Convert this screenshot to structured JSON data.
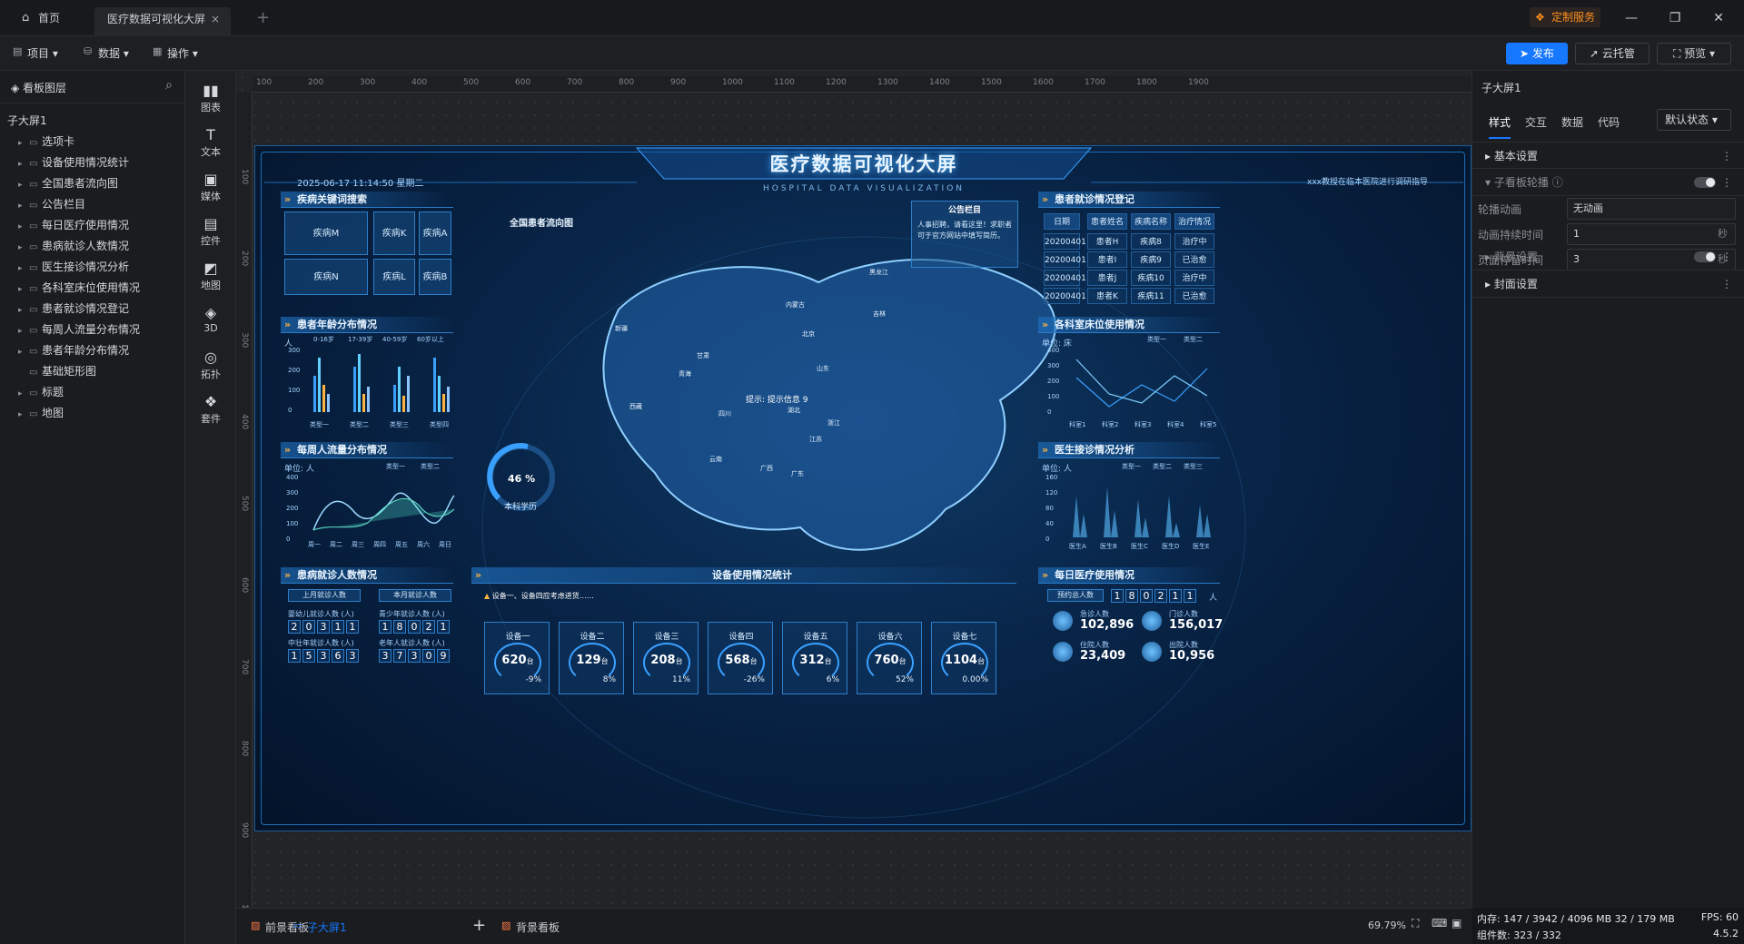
{
  "tabs": {
    "home": "首页",
    "active": "医疗数据可视化大屏",
    "close": "×",
    "add": "+"
  },
  "header": {
    "custom_service": "定制服务",
    "minimize": "—",
    "restore": "❐",
    "close": "✕"
  },
  "toolbar": {
    "menus": [
      {
        "label": "项目",
        "icon": "▤"
      },
      {
        "label": "数据",
        "icon": "⛁"
      },
      {
        "label": "操作",
        "icon": "▦"
      }
    ],
    "publish": "发布",
    "cloud": "云托管",
    "preview": "预览"
  },
  "layers": {
    "title": "看板图层",
    "root": "子大屏1",
    "items": [
      "选项卡",
      "设备使用情况统计",
      "全国患者流向图",
      "公告栏目",
      "每日医疗使用情况",
      "患病就诊人数情况",
      "医生接诊情况分析",
      "各科室床位使用情况",
      "患者就诊情况登记",
      "每周人流量分布情况",
      "患者年龄分布情况",
      "基础矩形图",
      "标题",
      "地图"
    ]
  },
  "components": [
    {
      "label": "图表",
      "icon": "▮▮"
    },
    {
      "label": "文本",
      "icon": "T"
    },
    {
      "label": "媒体",
      "icon": "▣"
    },
    {
      "label": "控件",
      "icon": "▤"
    },
    {
      "label": "地图",
      "icon": "◩"
    },
    {
      "label": "3D",
      "icon": "◈"
    },
    {
      "label": "拓扑",
      "icon": "◎"
    },
    {
      "label": "套件",
      "icon": "❖"
    }
  ],
  "ruler": {
    "h": [
      "100",
      "200",
      "300",
      "400",
      "500",
      "600",
      "700",
      "800",
      "900",
      "1000",
      "1100",
      "1200",
      "1300",
      "1400",
      "1500",
      "1600",
      "1700",
      "1800",
      "1900"
    ],
    "v": [
      "100",
      "200",
      "300",
      "400",
      "500",
      "600",
      "700",
      "800",
      "900",
      "1000"
    ]
  },
  "bottom": {
    "tabs": [
      "前景看板",
      "子大屏1",
      "背景看板"
    ],
    "add": "+",
    "zoom": "69.79%"
  },
  "right": {
    "title": "子大屏1",
    "tabs": [
      "样式",
      "交互",
      "数据",
      "代码"
    ],
    "state": "默认状态",
    "sections": {
      "basic": "基本设置",
      "carousel": "子看板轮播",
      "background": "背景设置",
      "cover": "封面设置"
    },
    "fields": [
      {
        "label": "轮播动画",
        "value": "无动画",
        "unit": ""
      },
      {
        "label": "动画持续时间",
        "value": "1",
        "unit": "秒"
      },
      {
        "label": "页面停留时间",
        "value": "3",
        "unit": "秒"
      }
    ]
  },
  "status": {
    "memory": "内存: 147 / 3942 / 4096 MB  32 / 179 MB",
    "fps": "FPS: 60",
    "components": "组件数: 323 / 332",
    "version": "4.5.2"
  },
  "dashboard": {
    "title": "医疗数据可视化大屏",
    "subtitle": "HOSPITAL DATA VISUALIZATION",
    "datetime": "2025-06-17 11:14:50 星期二",
    "notice": "xxx教授在临本医院进行调研指导",
    "keywords_title": "疾病关键词搜索",
    "keywords": [
      "疾病M",
      "疾病K",
      "疾病A",
      "疾病N",
      "疾病L",
      "疾病B"
    ],
    "age_title": "患者年龄分布情况",
    "age_unit": "人",
    "age_legend": [
      "0-16岁",
      "17-39岁",
      "40-59岁",
      "60岁以上"
    ],
    "age_categories": [
      "类型一",
      "类型二",
      "类型三",
      "类型四"
    ],
    "age_yticks": [
      "300",
      "200",
      "100",
      "0"
    ],
    "flow_title": "每周人流量分布情况",
    "flow_unit": "单位: 人",
    "flow_legend": [
      "类型一",
      "类型二"
    ],
    "flow_categories": [
      "周一",
      "周二",
      "周三",
      "周四",
      "周五",
      "周六",
      "周日"
    ],
    "flow_yticks": [
      "400",
      "300",
      "200",
      "100",
      "0"
    ],
    "visits_title": "患病就诊人数情况",
    "visits_tabs": [
      "上月就诊人数",
      "本月就诊人数"
    ],
    "visits": [
      {
        "label": "婴幼儿就诊人数 (人)",
        "digits": [
          "2",
          "0",
          "3",
          "1",
          "1"
        ]
      },
      {
        "label": "青少年就诊人数 (人)",
        "digits": [
          "1",
          "8",
          "0",
          "2",
          "1"
        ]
      },
      {
        "label": "中壮年就诊人数 (人)",
        "digits": [
          "1",
          "5",
          "3",
          "6",
          "3"
        ]
      },
      {
        "label": "老年人就诊人数 (人)",
        "digits": [
          "3",
          "7",
          "3",
          "0",
          "9"
        ]
      }
    ],
    "map_title": "全国患者流向图",
    "map_tip": "提示: 提示信息 9",
    "map_labels": [
      "新疆",
      "西藏",
      "青海",
      "甘肃",
      "四川",
      "云南",
      "内蒙古",
      "黑龙江",
      "吉林",
      "北京",
      "山东",
      "湖北",
      "广西",
      "广东",
      "江苏",
      "浙江"
    ],
    "gauge_value": "46 %",
    "gauge_label": "本科学历",
    "notice_title": "公告栏目",
    "notice_text": "人事招聘，请看这里！求职者可于官方网站中填写简历。",
    "register_title": "患者就诊情况登记",
    "register_head": [
      "日期",
      "患者姓名",
      "疾病名称",
      "治疗情况"
    ],
    "register_rows": [
      [
        "20200401",
        "患者H",
        "疾病8",
        "治疗中"
      ],
      [
        "20200401",
        "患者I",
        "疾病9",
        "已治愈"
      ],
      [
        "20200401",
        "患者J",
        "疾病10",
        "治疗中"
      ],
      [
        "20200401",
        "患者K",
        "疾病11",
        "已治愈"
      ]
    ],
    "bed_title": "各科室床位使用情况",
    "bed_unit": "单位: 床",
    "bed_legend": [
      "类型一",
      "类型二"
    ],
    "bed_categories": [
      "科室1",
      "科室2",
      "科室3",
      "科室4",
      "科室5"
    ],
    "bed_yticks": [
      "400",
      "300",
      "200",
      "100",
      "0"
    ],
    "doctor_title": "医生接诊情况分析",
    "doctor_unit": "单位: 人",
    "doctor_legend": [
      "类型一",
      "类型二",
      "类型三"
    ],
    "doctor_categories": [
      "医生A",
      "医生B",
      "医生C",
      "医生D",
      "医生E"
    ],
    "doctor_yticks": [
      "160",
      "120",
      "80",
      "40",
      "0"
    ],
    "devices_title": "设备使用情况统计",
    "devices_alert": "设备一、设备四应考虑进货……",
    "devices": [
      {
        "name": "设备一",
        "value": "620",
        "pct": "-9%"
      },
      {
        "name": "设备二",
        "value": "129",
        "pct": "8%"
      },
      {
        "name": "设备三",
        "value": "208",
        "pct": "11%"
      },
      {
        "name": "设备四",
        "value": "568",
        "pct": "-26%"
      },
      {
        "name": "设备五",
        "value": "312",
        "pct": "6%"
      },
      {
        "name": "设备六",
        "value": "760",
        "pct": "52%"
      },
      {
        "name": "设备七",
        "value": "1104",
        "pct": "0.00%"
      }
    ],
    "device_unit": "台",
    "daily_title": "每日医疗使用情况",
    "daily_total_label": "预约总人数",
    "daily_total_digits": [
      "1",
      "8",
      "0",
      "2",
      "1",
      "1"
    ],
    "daily_total_unit": "人",
    "daily_stats": [
      {
        "label": "急诊人数",
        "value": "102,896"
      },
      {
        "label": "门诊人数",
        "value": "156,017"
      },
      {
        "label": "住院人数",
        "value": "23,409"
      },
      {
        "label": "出院人数",
        "value": "10,956"
      }
    ]
  }
}
